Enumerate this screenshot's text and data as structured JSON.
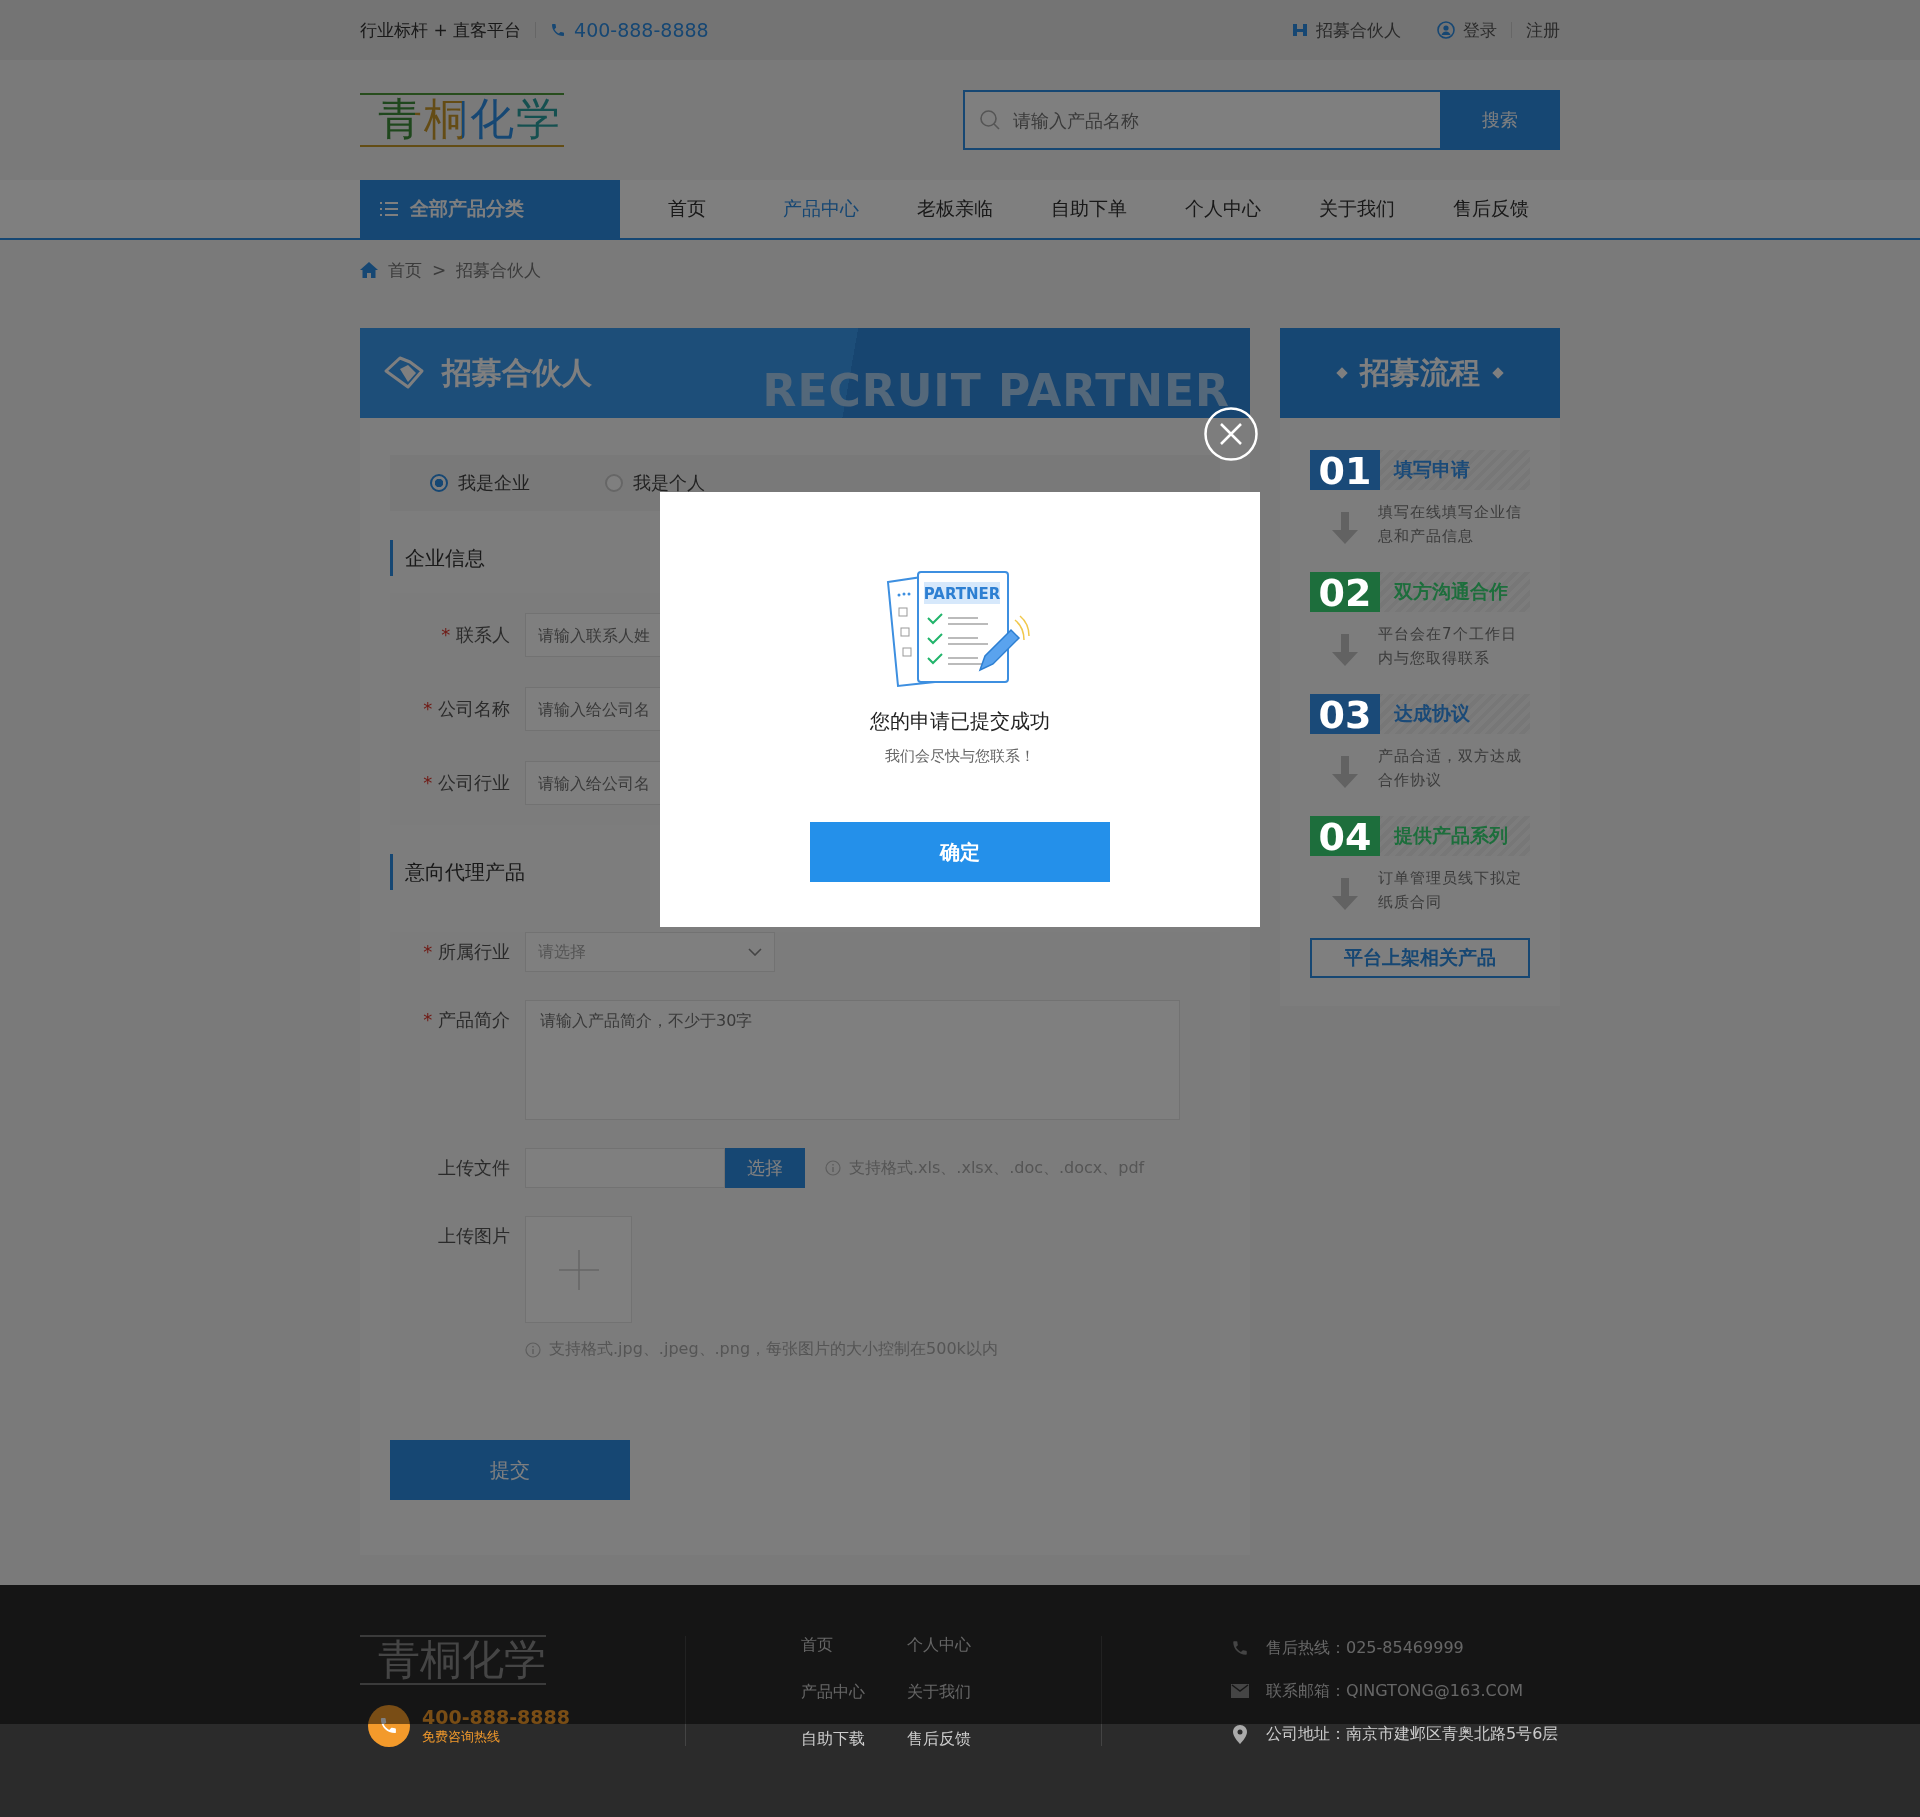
{
  "top_bar": {
    "slogan": "行业标杆 + 直客平台",
    "phone": "400-888-8888",
    "links": [
      {
        "kind": "partner",
        "label": "招募合伙人"
      },
      {
        "kind": "login",
        "label": "登录"
      },
      {
        "kind": "register",
        "label": "注册"
      }
    ]
  },
  "header": {
    "logo": "青桐化学",
    "search": {
      "placeholder": "请输入产品名称",
      "button": "搜索"
    }
  },
  "nav": {
    "category_button": "全部产品分类",
    "items": [
      {
        "label": "首页",
        "selected": false
      },
      {
        "label": "产品中心",
        "selected": true
      },
      {
        "label": "老板亲临",
        "selected": false
      },
      {
        "label": "自助下单",
        "selected": false
      },
      {
        "label": "个人中心",
        "selected": false
      },
      {
        "label": "关于我们",
        "selected": false
      },
      {
        "label": "售后反馈",
        "selected": false
      }
    ]
  },
  "breadcrumb": {
    "items": [
      "首页",
      "招募合伙人"
    ],
    "separator": ">"
  },
  "form": {
    "title": "招募合伙人",
    "watermark": "RECRUIT PARTNER",
    "types": [
      {
        "label": "我是企业",
        "selected": true
      },
      {
        "label": "我是个人",
        "selected": false
      }
    ],
    "sections": [
      {
        "title": "企业信息",
        "fields": [
          {
            "kind": "text",
            "mark": "*",
            "label": "联系人",
            "placeholder": "请输入联系人姓"
          },
          {
            "kind": "text",
            "mark": "*",
            "label": "公司名称",
            "placeholder": "请输入给公司名"
          },
          {
            "kind": "text",
            "mark": "*",
            "label": "公司行业",
            "placeholder": "请输入给公司名"
          }
        ]
      },
      {
        "title": "意向代理产品",
        "fields": [
          {
            "kind": "select",
            "mark": "*",
            "label": "所属行业",
            "placeholder": "请选择"
          },
          {
            "kind": "textarea",
            "mark": "*",
            "label": "产品简介",
            "placeholder": "请输入产品简介，不少于30字"
          },
          {
            "kind": "file",
            "label": "上传文件",
            "button": "选择",
            "hint": "支持格式.xls、.xlsx、.doc、.docx、pdf"
          },
          {
            "kind": "image",
            "label": "上传图片",
            "hint": "支持格式.jpg、.jpeg、.png，每张图片的大小控制在500k以内"
          }
        ]
      }
    ],
    "submit": "提交"
  },
  "process": {
    "title": "招募流程",
    "steps": [
      {
        "number": "01",
        "title": "填写申请",
        "text": "填写在线填写企业信息和产品信息",
        "color": "#1a4a78"
      },
      {
        "number": "02",
        "title": "双方沟通合作",
        "text": "平台会在7个工作日内与您取得联系",
        "color": "#1d6e3c"
      },
      {
        "number": "03",
        "title": "达成协议",
        "text": "产品合适，双方达成合作协议",
        "color": "#1a4a78"
      },
      {
        "number": "04",
        "title": "提供产品系列",
        "text": "订单管理员线下拟定纸质合同",
        "color": "#1d6e3c"
      }
    ],
    "button": "平台上架相关产品"
  },
  "footer": {
    "logo": "青桐化学",
    "phone": "400-888-8888",
    "phone_caption": "免费咨询热线",
    "links": [
      "首页",
      "个人中心",
      "产品中心",
      "关于我们",
      "自助下载",
      "售后反馈"
    ],
    "contacts": [
      {
        "kind": "phone",
        "text": "售后热线：025-85469999"
      },
      {
        "kind": "mail",
        "text": "联系邮箱：QINGTONG@163.COM"
      },
      {
        "kind": "address",
        "text": "公司地址：南京市建邺区青奥北路5号6层"
      }
    ]
  },
  "dialog": {
    "illustration_label": "PARTNER",
    "title": "您的申请已提交成功",
    "message": "我们会尽快与您联系！",
    "button": "确定"
  }
}
